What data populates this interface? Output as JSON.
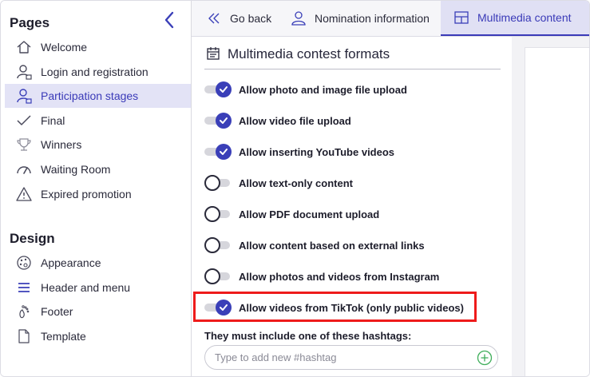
{
  "sidebar": {
    "pages_heading": "Pages",
    "design_heading": "Design",
    "pages": [
      {
        "label": "Welcome",
        "icon": "home-icon"
      },
      {
        "label": "Login and registration",
        "icon": "user-lock-icon"
      },
      {
        "label": "Participation stages",
        "icon": "user-lock-icon",
        "active": true
      },
      {
        "label": "Final",
        "icon": "checkmark-icon"
      },
      {
        "label": "Winners",
        "icon": "trophy-icon"
      },
      {
        "label": "Waiting Room",
        "icon": "speedometer-icon"
      },
      {
        "label": "Expired promotion",
        "icon": "warning-icon"
      }
    ],
    "design": [
      {
        "label": "Appearance",
        "icon": "palette-icon"
      },
      {
        "label": "Header and menu",
        "icon": "menu-icon"
      },
      {
        "label": "Footer",
        "icon": "footprint-icon"
      },
      {
        "label": "Template",
        "icon": "document-icon"
      }
    ]
  },
  "tabs": [
    {
      "label": "Go back",
      "icon": "double-chevron-left-icon"
    },
    {
      "label": "Nomination information",
      "icon": "user-icon"
    },
    {
      "label": "Multimedia content",
      "icon": "layout-icon",
      "active": true
    }
  ],
  "panel": {
    "title": "Multimedia contest formats",
    "options": [
      {
        "label": "Allow photo and image file upload",
        "enabled": true
      },
      {
        "label": "Allow video file upload",
        "enabled": true
      },
      {
        "label": "Allow inserting YouTube videos",
        "enabled": true
      },
      {
        "label": "Allow text-only content",
        "enabled": false
      },
      {
        "label": "Allow PDF document upload",
        "enabled": false
      },
      {
        "label": "Allow content based on external links",
        "enabled": false
      },
      {
        "label": "Allow photos and videos from Instagram",
        "enabled": false
      },
      {
        "label": "Allow videos from TikTok (only public videos)",
        "enabled": true
      }
    ],
    "hashtag_label": "They must include one of these hashtags:",
    "hashtag_placeholder": "Type to add new #hashtag"
  },
  "colors": {
    "accent": "#3a3fb8",
    "active_bg": "#e3e3f6",
    "highlight_border": "#ee1b1b"
  }
}
